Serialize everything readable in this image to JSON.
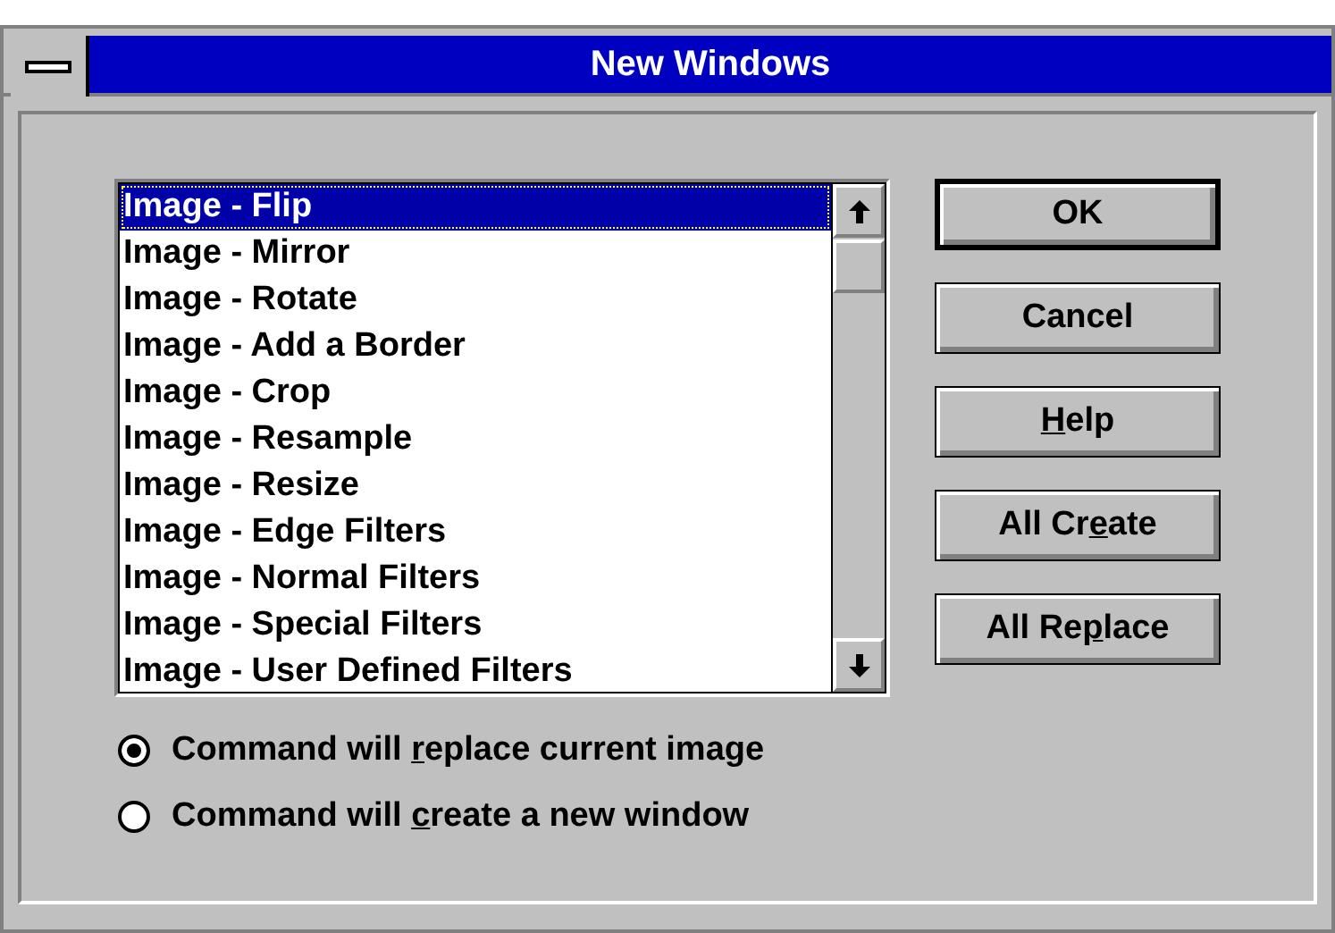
{
  "window": {
    "title": "New Windows"
  },
  "list": {
    "items": [
      {
        "label": "Image - Flip",
        "selected": true
      },
      {
        "label": "Image - Mirror",
        "selected": false
      },
      {
        "label": "Image - Rotate",
        "selected": false
      },
      {
        "label": "Image - Add a Border",
        "selected": false
      },
      {
        "label": "Image - Crop",
        "selected": false
      },
      {
        "label": "Image - Resample",
        "selected": false
      },
      {
        "label": "Image - Resize",
        "selected": false
      },
      {
        "label": "Image - Edge Filters",
        "selected": false
      },
      {
        "label": "Image - Normal Filters",
        "selected": false
      },
      {
        "label": "Image - Special Filters",
        "selected": false
      },
      {
        "label": "Image - User Defined Filters",
        "selected": false
      }
    ]
  },
  "buttons": [
    {
      "after": "OK",
      "default": true
    },
    {
      "after": "Cancel",
      "default": false
    },
    {
      "key": "H",
      "after": "elp",
      "default": false
    },
    {
      "before": "All Cr",
      "key": "e",
      "after": "ate",
      "default": false
    },
    {
      "before": "All Re",
      "key": "p",
      "after": "lace",
      "default": false
    }
  ],
  "options": [
    {
      "before": "Command will ",
      "key": "r",
      "after": "eplace current image",
      "selected": true
    },
    {
      "before": "Command will ",
      "key": "c",
      "after": "reate a new window",
      "selected": false
    }
  ]
}
